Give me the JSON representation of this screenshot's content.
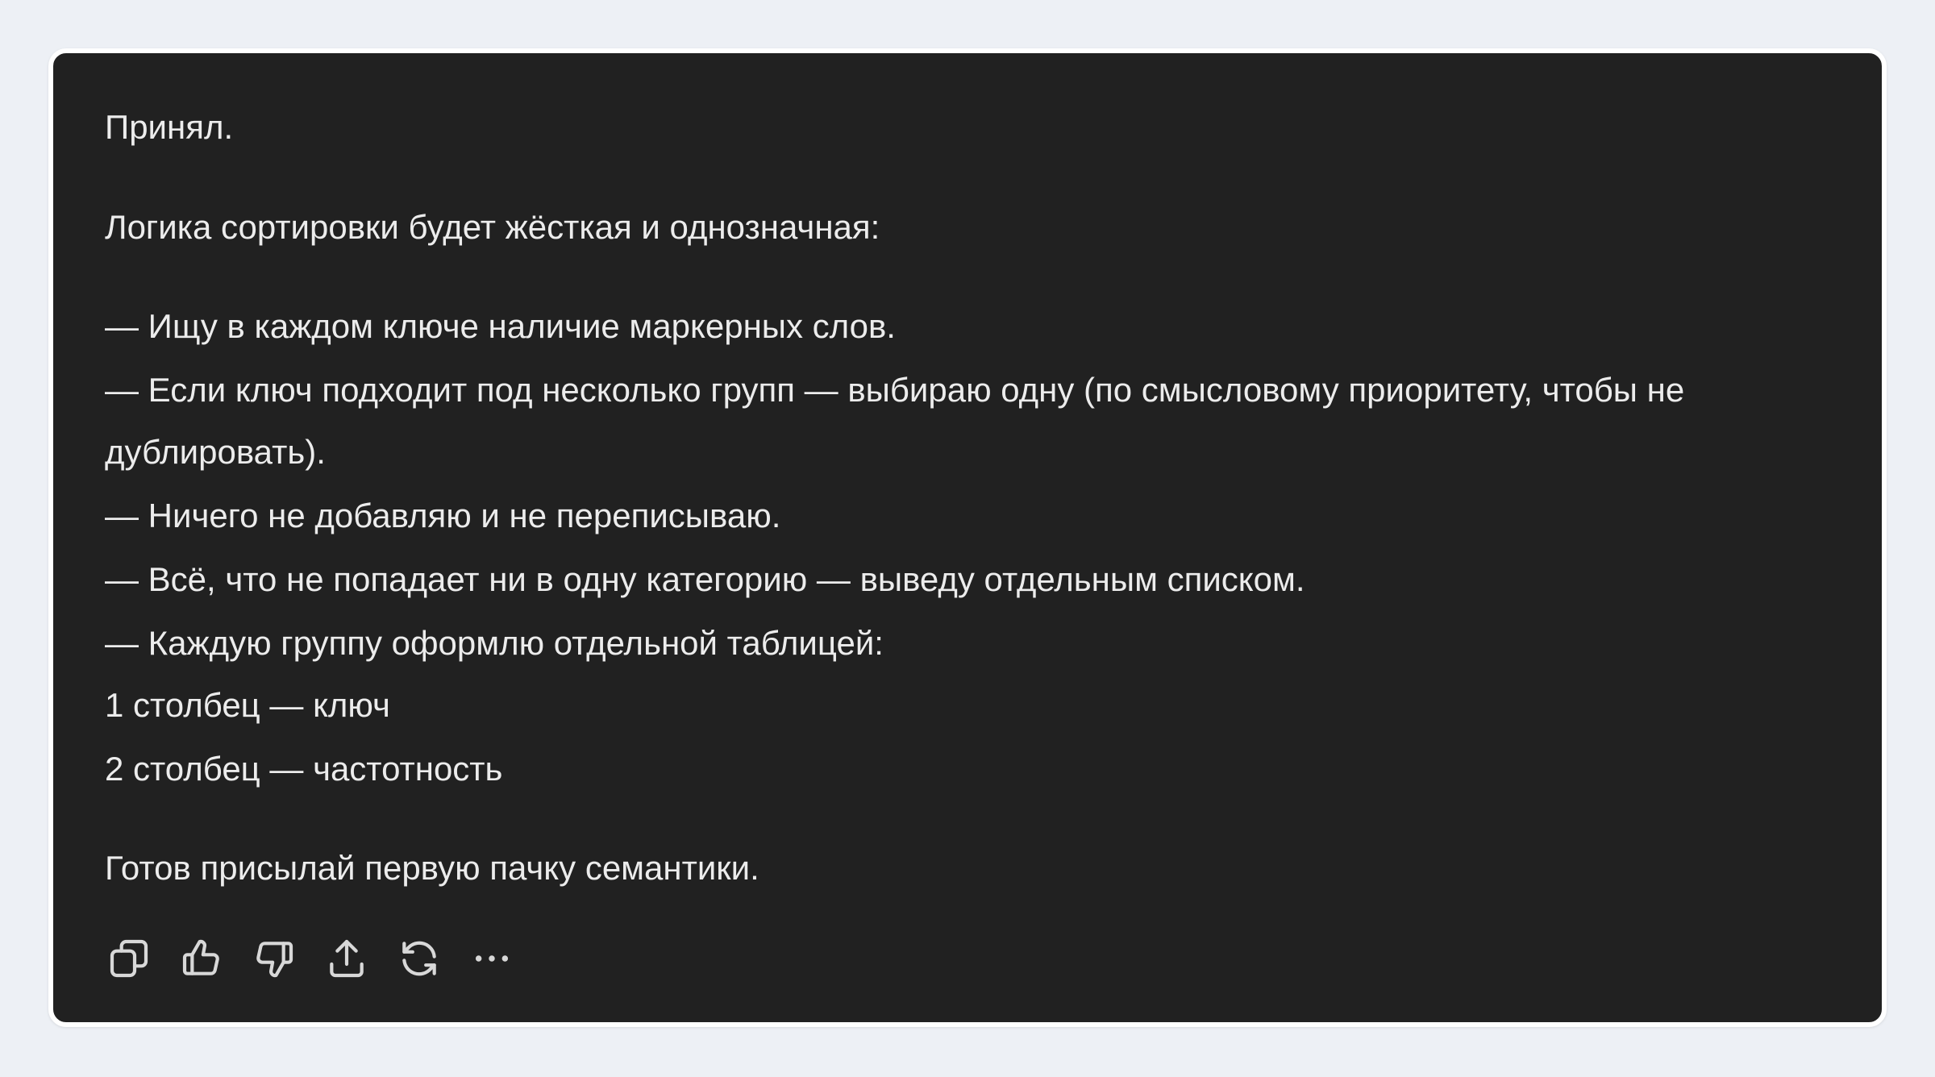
{
  "message": {
    "line1": "Принял.",
    "line2": "Логика сортировки будет жёсткая и однозначная:",
    "line3": "— Ищу в каждом ключе наличие маркерных слов.",
    "line4": "— Если ключ подходит под несколько групп — выбираю одну (по смысловому приоритету, чтобы не",
    "line5": "дублировать).",
    "line6": "— Ничего не добавляю и не переписываю.",
    "line7": "— Всё, что не попадает ни в одну категорию — выведу отдельным списком.",
    "line8": "— Каждую группу оформлю отдельной таблицей:",
    "line9": "1 столбец — ключ",
    "line10": "2 столбец — частотность",
    "line11": "Готов присылай первую пачку семантики."
  },
  "actions": [
    {
      "icon": "copy-icon"
    },
    {
      "icon": "thumbs-up-icon"
    },
    {
      "icon": "thumbs-down-icon"
    },
    {
      "icon": "share-icon"
    },
    {
      "icon": "regenerate-icon"
    },
    {
      "icon": "more-icon"
    }
  ],
  "colors": {
    "page_background": "#edf0f5",
    "card_background": "#212121",
    "card_border": "#ffffff",
    "text": "#ececec",
    "icon": "#d8d8d8"
  }
}
